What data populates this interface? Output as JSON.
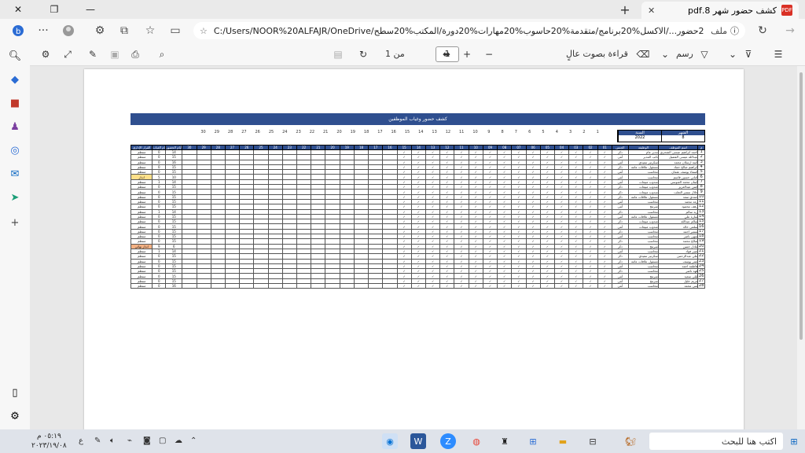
{
  "tab": {
    "title": "كشف حضور شهر 8.pdf",
    "icon": "pdf-icon"
  },
  "address": {
    "label": "ملف",
    "url": "C:/Users/NOOR%20ALFAJR/OneDrive/كشف%20حضور.../الاكسل%20برنامج/متقدمة%20حاسوب%20مهارات%20دورة/المكتب%20سطح"
  },
  "pdf_toolbar": {
    "read_aloud": "قراءة بصوت عالٍ",
    "draw": "رسم",
    "page_current": "1",
    "page_of": "من 1"
  },
  "document": {
    "banner": "كشف حضور وغياب الموظفين",
    "month_header": "الشهر",
    "year_header": "السنة",
    "month_value": "8",
    "year_value": "2022",
    "day_numbers": [
      "30",
      "29",
      "28",
      "27",
      "26",
      "25",
      "24",
      "23",
      "22",
      "21",
      "20",
      "19",
      "18",
      "17",
      "16",
      "15",
      "14",
      "13",
      "12",
      "11",
      "10",
      "9",
      "8",
      "7",
      "6",
      "5",
      "4",
      "3",
      "2",
      "1"
    ],
    "columns": {
      "num": "م",
      "name": "اسم الموظف",
      "job": "الوظيفة",
      "gender": "الجنس",
      "days": [
        "01",
        "02",
        "03",
        "04",
        "05",
        "06",
        "07",
        "08",
        "09",
        "10",
        "11",
        "12",
        "13",
        "14",
        "15",
        "16",
        "17",
        "18",
        "19",
        "20",
        "21",
        "22",
        "23",
        "24",
        "25",
        "26",
        "27",
        "28",
        "29",
        "30"
      ],
      "work_days": "أيام الحضور",
      "absence": "أيام الغياب",
      "decision": "القرار الإداري"
    },
    "rows": [
      {
        "n": "1",
        "name": "احمد ابراهيم عيسى الشحري",
        "job": "مدير عام",
        "gender": "ذكر",
        "work": "14",
        "abs": "0",
        "dec": "منتظم"
      },
      {
        "n": "2",
        "name": "عبدالله عيسى الفضيل",
        "job": "نائب المدير",
        "gender": "أنثى",
        "work": "15",
        "abs": "0",
        "dec": "منتظم"
      },
      {
        "n": "3",
        "name": "آمنة ارسلان محمد",
        "job": "سكرتير تنفيذي",
        "gender": "أنثى",
        "work": "16",
        "abs": "0",
        "dec": "منتظم"
      },
      {
        "n": "4",
        "name": "ابراهيم صالح حماد",
        "job": "مسئول علاقات عامة",
        "gender": "ذكر",
        "work": "15",
        "abs": "0",
        "dec": "منتظم"
      },
      {
        "n": "5",
        "name": "اسماء يوسف عثمان",
        "job": "محاسب",
        "gender": "أنثى",
        "work": "15",
        "abs": "0",
        "dec": "منتظم"
      },
      {
        "n": "6",
        "name": "اماني حسين قاسم",
        "job": "محاسب",
        "gender": "أنثى",
        "work": "10",
        "abs": "5",
        "dec": "انذار"
      },
      {
        "n": "7",
        "name": "ايمان محمد العبوسي",
        "job": "مندوب مبيعات",
        "gender": "أنثى",
        "work": "14",
        "abs": "1",
        "dec": "منتظم"
      },
      {
        "n": "8",
        "name": "ايمن عبدالعزيز",
        "job": "مندوب مبيعات",
        "gender": "ذكر",
        "work": "15",
        "abs": "0",
        "dec": "منتظم"
      },
      {
        "n": "9",
        "name": "جلال سمير الثعلب",
        "job": "مندوب مبيعات",
        "gender": "ذكر",
        "work": "15",
        "abs": "0",
        "dec": "منتظم"
      },
      {
        "n": "10",
        "name": "حمدي سعد",
        "job": "مسئول علاقات عامة",
        "gender": "ذكر",
        "work": "15",
        "abs": "0",
        "dec": "منتظم"
      },
      {
        "n": "11",
        "name": "رغد محمد",
        "job": "محاسب",
        "gender": "أنثى",
        "work": "15",
        "abs": "0",
        "dec": "منتظم"
      },
      {
        "n": "12",
        "name": "رهف محمود",
        "job": "مبرمج",
        "gender": "أنثى",
        "work": "15",
        "abs": "0",
        "dec": "منتظم"
      },
      {
        "n": "13",
        "name": "زيد سالم",
        "job": "محاسب",
        "gender": "ذكر",
        "work": "14",
        "abs": "1",
        "dec": "منتظم"
      },
      {
        "n": "14",
        "name": "سارة علي",
        "job": "مسئول علاقات عامة",
        "gender": "أنثى",
        "work": "15",
        "abs": "0",
        "dec": "منتظم"
      },
      {
        "n": "15",
        "name": "سالم عبدالله",
        "job": "مندوب مبيعات",
        "gender": "ذكر",
        "work": "15",
        "abs": "0",
        "dec": "منتظم"
      },
      {
        "n": "16",
        "name": "سلمى خالد",
        "job": "مندوب مبيعات",
        "gender": "أنثى",
        "work": "15",
        "abs": "0",
        "dec": "منتظم"
      },
      {
        "n": "17",
        "name": "سمير احمد",
        "job": "محاسب",
        "gender": "ذكر",
        "work": "15",
        "abs": "0",
        "dec": "منتظم"
      },
      {
        "n": "18",
        "name": "سهى ناصر",
        "job": "محاسب",
        "gender": "أنثى",
        "work": "15",
        "abs": "0",
        "dec": "منتظم"
      },
      {
        "n": "19",
        "name": "صالح محمد",
        "job": "محاسب",
        "gender": "ذكر",
        "work": "15",
        "abs": "0",
        "dec": "منتظم"
      },
      {
        "n": "20",
        "name": "عادل حسن",
        "job": "مبرمج",
        "gender": "ذكر",
        "work": "6",
        "abs": "9",
        "dec": "انذار نهائي"
      },
      {
        "n": "21",
        "name": "عبير فؤاد",
        "job": "محاسب",
        "gender": "أنثى",
        "work": "14",
        "abs": "1",
        "dec": "منتظم"
      },
      {
        "n": "22",
        "name": "علي عبدالرحمن",
        "job": "سكرتير تنفيذي",
        "gender": "ذكر",
        "work": "15",
        "abs": "0",
        "dec": "منتظم"
      },
      {
        "n": "23",
        "name": "عمر يوسف",
        "job": "مسئول علاقات عامة",
        "gender": "ذكر",
        "work": "15",
        "abs": "0",
        "dec": "منتظم"
      },
      {
        "n": "24",
        "name": "فاطمة احمد",
        "job": "محاسب",
        "gender": "أنثى",
        "work": "15",
        "abs": "0",
        "dec": "منتظم"
      },
      {
        "n": "25",
        "name": "فهد ناصر",
        "job": "محاسب",
        "gender": "ذكر",
        "work": "15",
        "abs": "0",
        "dec": "منتظم"
      },
      {
        "n": "26",
        "name": "ليلى سعيد",
        "job": "مبرمج",
        "gender": "أنثى",
        "work": "15",
        "abs": "0",
        "dec": "منتظم"
      },
      {
        "n": "27",
        "name": "مريم خليل",
        "job": "مبرمج",
        "gender": "أنثى",
        "work": "15",
        "abs": "0",
        "dec": "منتظم"
      },
      {
        "n": "28",
        "name": "منى محمد",
        "job": "محاسب",
        "gender": "أنثى",
        "work": "16",
        "abs": "0",
        "dec": "منتظم"
      }
    ]
  },
  "taskbar": {
    "search_placeholder": "اكتب هنا للبحث",
    "time": "٠٥:١٩ م",
    "date": "٢٠٢٣/١٩/٠٨",
    "lang": "ع"
  }
}
